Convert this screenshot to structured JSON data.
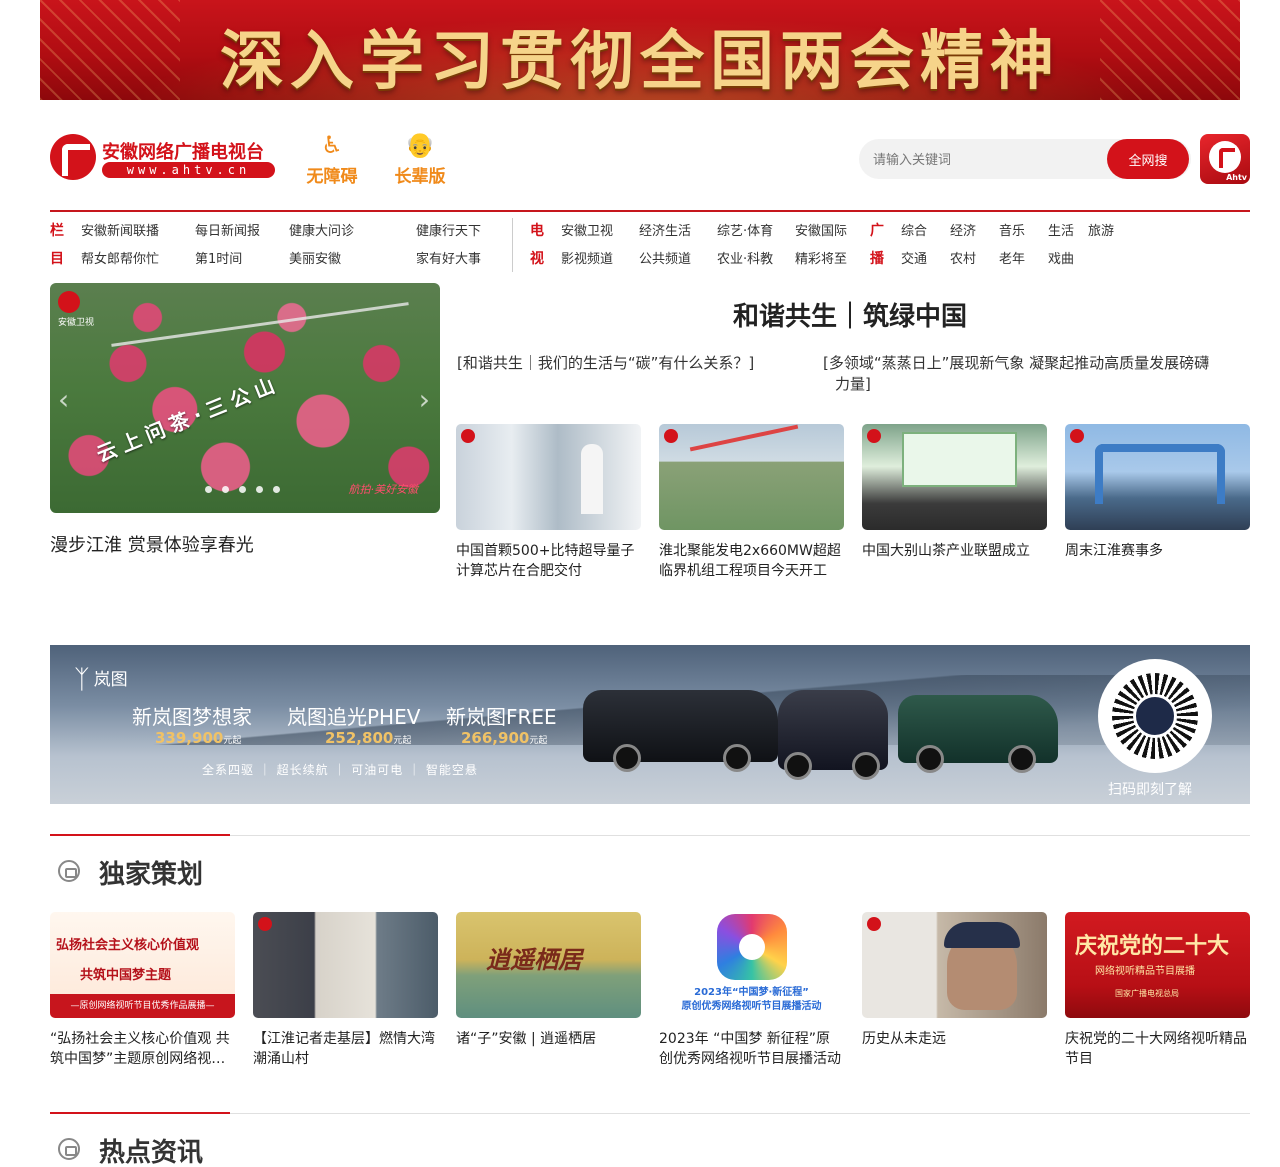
{
  "banner": {
    "text": "深入学习贯彻全国两会精神"
  },
  "header": {
    "logo_name": "安徽网络广播电视台",
    "logo_url": "www.ahtv.cn",
    "accessible_label": "无障碍",
    "elder_label": "长辈版",
    "search_placeholder": "请输入关键词",
    "search_button": "全网搜",
    "app_tag": "Ahtv"
  },
  "nav": {
    "column_cat": [
      "栏",
      "目"
    ],
    "column_row1": [
      "安徽新闻联播",
      "每日新闻报",
      "健康大问诊",
      "健康行天下"
    ],
    "column_row2": [
      "帮女郎帮你忙",
      "第1时间",
      "美丽安徽",
      "家有好大事"
    ],
    "tv_cat": [
      "电",
      "视"
    ],
    "tv_row1": [
      "安徽卫视",
      "经济生活",
      "综艺·体育",
      "安徽国际"
    ],
    "tv_row2": [
      "影视频道",
      "公共频道",
      "农业·科教",
      "精彩将至"
    ],
    "radio_cat": [
      "广",
      "播"
    ],
    "radio_row1": [
      "综合",
      "经济",
      "音乐",
      "生活",
      "旅游"
    ],
    "radio_row2": [
      "交通",
      "农村",
      "老年",
      "戏曲"
    ]
  },
  "carousel": {
    "image_text": "云上问茶·三公山",
    "logo_text": "安徽卫视",
    "watermark": "航拍·美好安徽",
    "title": "漫步江淮 赏景体验享春光",
    "slides_count": 5
  },
  "headline": {
    "title": "和谐共生｜筑绿中国",
    "sub_link_1": "[和谐共生｜我们的生活与“碳”有什么关系？]",
    "sub_link_2_line1": "[多领域“蒸蒸日上”展现新气象 凝聚起推动高质量发展磅礴",
    "sub_link_2_line2": "力量]"
  },
  "news_cards": [
    {
      "caption": "中国首颗500+比特超导量子计算芯片在合肥交付"
    },
    {
      "caption": "淮北聚能发电2x660MW超超临界机组工程项目今天开工"
    },
    {
      "caption": "中国大别山茶产业联盟成立"
    },
    {
      "caption": "周末江淮赛事多"
    }
  ],
  "ad": {
    "brand": "岚图",
    "models": [
      {
        "name": "新岚图梦想家",
        "price": "339,900",
        "unit": "元起"
      },
      {
        "name": "岚图追光PHEV",
        "price": "252,800",
        "unit": "元起"
      },
      {
        "name": "新岚图FREE",
        "price": "266,900",
        "unit": "元起"
      }
    ],
    "features": "全系四驱 ｜ 超长续航 ｜ 可油可电 ｜ 智能空悬",
    "scan_text": "扫码即刻了解"
  },
  "section_exclusive": {
    "title": "独家策划",
    "cards": [
      {
        "caption": "“弘扬社会主义核心价值观 共筑中国梦”主题原创网络视听作品展播",
        "img_text_1": "弘扬社会主义核心价值观",
        "img_text_2": "共筑中国梦主题",
        "img_foot": "—原创网络视听节目优秀作品展播—"
      },
      {
        "caption": "【江淮记者走基层】燃情大湾 潮涌山村"
      },
      {
        "caption": "诸“子”安徽 | 逍遥栖居",
        "img_text_1": "逍遥栖居"
      },
      {
        "caption": "2023年 “中国梦 新征程”原创优秀网络视听节目展播活动",
        "img_text_1": "2023年“中国梦·新征程”",
        "img_text_2": "原创优秀网络视听节目展播活动"
      },
      {
        "caption": "历史从未走远"
      },
      {
        "caption": "庆祝党的二十大网络视听精品节目",
        "img_text_1": "庆祝党的二十大",
        "img_text_2": "网络视听精品节目展播",
        "img_text_3": "国家广播电视总局"
      }
    ]
  },
  "section_hot": {
    "title": "热点资讯"
  },
  "colors": {
    "brand_red": "#d3121a",
    "orange": "#f08a1a",
    "gold": "#f6d48a"
  },
  "icons": {
    "accessible": "wheelchair-icon",
    "elder": "elder-person-icon",
    "section": "section-bullet-icon"
  }
}
